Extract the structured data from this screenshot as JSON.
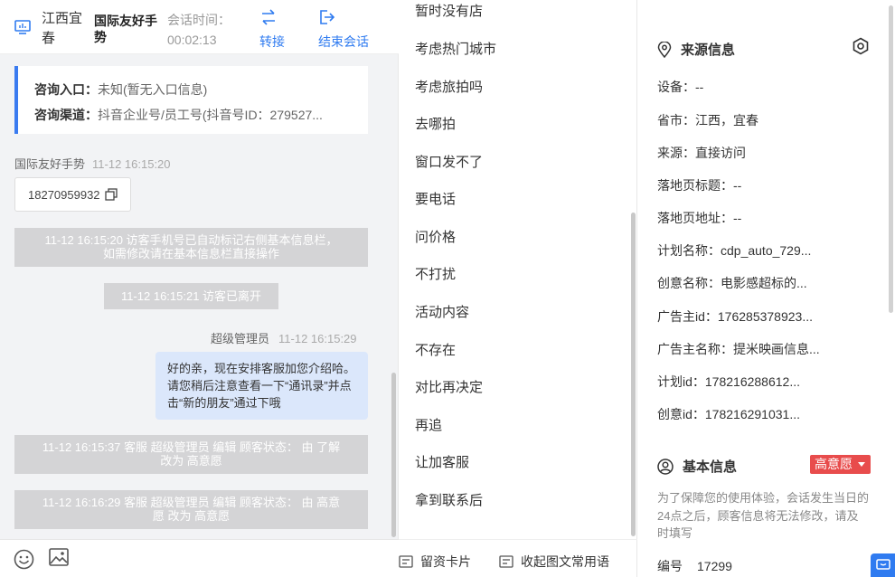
{
  "header": {
    "location": "江西宜春",
    "visitor_name": "国际友好手势",
    "time_label": "会话时间：",
    "time_value": "00:02:13",
    "transfer_label": "转接",
    "end_label": "结束会话"
  },
  "entry": {
    "entry_label": "咨询入口：",
    "entry_value": "未知(暂无入口信息)",
    "channel_label": "咨询渠道：",
    "channel_value": "抖音企业号/员工号(抖音号ID：279527..."
  },
  "messages": {
    "visitor_name": "国际友好手势",
    "visitor_time": "11-12 16:15:20",
    "phone": "18270959932",
    "sys1_line1": "11-12 16:15:20 访客手机号已自动标记右侧基本信息栏，",
    "sys1_line2": "如需修改请在基本信息栏直接操作",
    "sys2": "11-12 16:15:21 访客已离开",
    "agent_name": "超级管理员",
    "agent_time": "11-12 16:15:29",
    "agent_text": "好的亲，现在安排客服加您介绍哈。请您稍后注意查看一下“通讯录”并点击“新的朋友”通过下哦",
    "sys3_line1": "11-12 16:15:37 客服 超级管理员 编辑 顾客状态： 由 了解",
    "sys3_line2": "改为 高意愿",
    "sys4_line1": "11-12 16:16:29 客服 超级管理员 编辑 顾客状态： 由 高意",
    "sys4_line2": "愿 改为 高意愿"
  },
  "footer_icons": [
    "emoji-icon",
    "image-icon"
  ],
  "quick_phrases": {
    "items": [
      "暂时没有店",
      "考虑热门城市",
      "考虑旅拍吗",
      "去哪拍",
      "窗口发不了",
      "要电话",
      "问价格",
      "不打扰",
      "活动内容",
      "不存在",
      "对比再决定",
      "再追",
      "让加客服",
      "拿到联系后"
    ],
    "card_btn": "留资卡片",
    "collapse_btn": "收起图文常用语"
  },
  "source_info": {
    "title": "来源信息",
    "device": "设备：--",
    "province": "省市：江西，宜春",
    "source": "来源：直接访问",
    "landing_title": "落地页标题：--",
    "landing_url": "落地页地址：--",
    "plan_name": "计划名称：cdp_auto_729...",
    "creative_name": "创意名称：电影感超标的...",
    "advertiser_id": "广告主id：176285378923...",
    "advertiser_name": "广告主名称：提米映画信息...",
    "plan_id": "计划id：178216288612...",
    "creative_id": "创意id：178216291031..."
  },
  "basic_info": {
    "title": "基本信息",
    "intent_badge": "高意愿",
    "notice": "为了保障您的使用体验，会话发生当日的24点之后，顾客信息将无法修改，请及时填写",
    "id_label": "编号",
    "id_value": "17299"
  },
  "colors": {
    "accent": "#2f7bf0",
    "badge": "#e84c4c",
    "agent_bubble": "#dbe7fb",
    "sys_msg": "#d4d4d6"
  }
}
